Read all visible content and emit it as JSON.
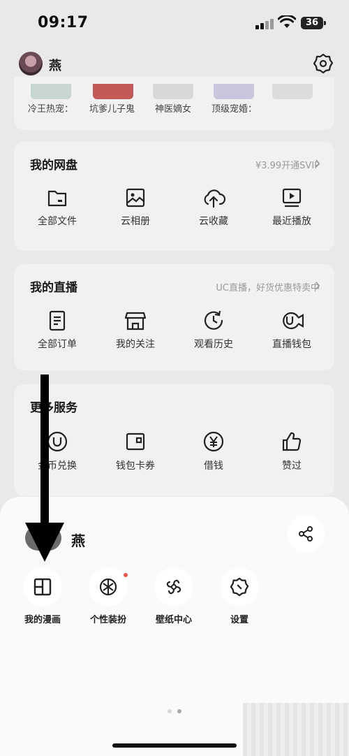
{
  "status_bar": {
    "time": "09:17",
    "battery": "36"
  },
  "header": {
    "username": "燕",
    "settings_icon": "gear-icon"
  },
  "top_row": {
    "items": [
      "冷王热宠：",
      "坑爹儿子鬼",
      "神医嫡女",
      "顶级宠婚："
    ]
  },
  "netdisk": {
    "title": "我的网盘",
    "link": "¥3.99开通SVIP",
    "items": [
      {
        "label": "全部文件",
        "icon": "folder-icon"
      },
      {
        "label": "云相册",
        "icon": "photo-icon"
      },
      {
        "label": "云收藏",
        "icon": "cloud-upload-icon"
      },
      {
        "label": "最近播放",
        "icon": "play-screen-icon"
      }
    ]
  },
  "live": {
    "title": "我的直播",
    "link": "UC直播，好货优惠特卖中",
    "items": [
      {
        "label": "全部订单",
        "icon": "document-icon"
      },
      {
        "label": "我的关注",
        "icon": "store-icon"
      },
      {
        "label": "观看历史",
        "icon": "history-icon"
      },
      {
        "label": "直播钱包",
        "icon": "live-wallet-icon"
      }
    ]
  },
  "more": {
    "title": "更多服务",
    "items": [
      {
        "label": "金币兑换",
        "icon": "coin-icon"
      },
      {
        "label": "钱包卡券",
        "icon": "wallet-icon"
      },
      {
        "label": "借钱",
        "icon": "yen-icon"
      },
      {
        "label": "赞过",
        "icon": "thumbs-up-icon"
      }
    ]
  },
  "sheet": {
    "username": "燕",
    "share_icon": "share-icon",
    "tiles": [
      {
        "label": "我的漫画",
        "icon": "comic-icon"
      },
      {
        "label": "个性装扮",
        "icon": "theme-icon"
      },
      {
        "label": "壁纸中心",
        "icon": "wallpaper-icon"
      },
      {
        "label": "设置",
        "icon": "gear-icon"
      }
    ]
  },
  "colors": {
    "sheet_bg": "#fafafa",
    "badge_red": "#f0554a",
    "arrow": "#000000"
  }
}
